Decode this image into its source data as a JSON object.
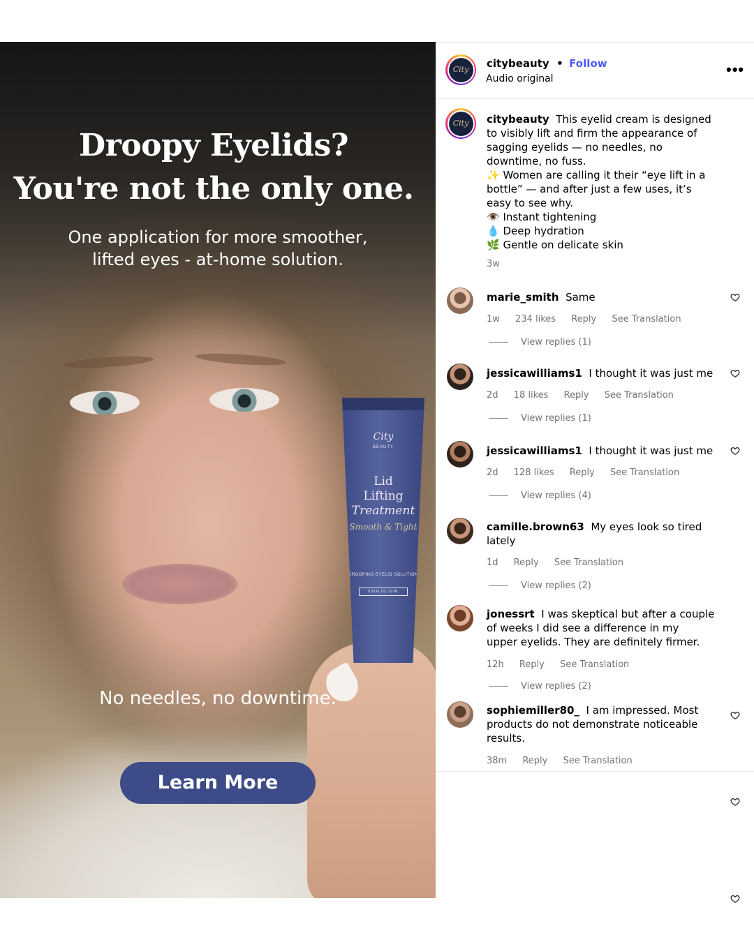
{
  "ad": {
    "headline_1": "Droopy Eyelids?",
    "headline_2": "You're not the only one.",
    "subline_1": "One application for more smoother,",
    "subline_2": "lifted eyes - at-home solution.",
    "tagline": "No needles, no downtime.",
    "cta_label": "Learn More",
    "product": {
      "brand": "City",
      "brand_sub": "BEAUTY",
      "title_1": "Lid",
      "title_2": "Lifting",
      "title_3": "Treatment",
      "subtitle": "Smooth & Tight",
      "desc": "DROOPING EYELID SOLUTION",
      "size": "0.33 FL OZ / 10 ML"
    }
  },
  "post": {
    "username": "citybeauty",
    "follow_label": "Follow",
    "separator": "•",
    "audio": "Audio original",
    "logo_text": "City",
    "caption": {
      "username": "citybeauty",
      "line1": "This eyelid cream is designed",
      "line2": "to visibly lift and firm the appearance of",
      "line3": "sagging eyelids — no needles, no",
      "line4": "downtime, no fuss.",
      "line5": "✨ Women are calling it their “eye lift in a",
      "line6": "bottle” — and after just a few uses, it’s",
      "line7": "easy to see why.",
      "line8": "👁️ Instant tightening",
      "line9": "💧 Deep hydration",
      "line10": "🌿 Gentle on delicate skin",
      "time": "3w"
    }
  },
  "comments": [
    {
      "user": "marie_smith",
      "text_1": "Same",
      "text_2": "",
      "text_3": "",
      "time": "1w",
      "likes": "234 likes",
      "reply": "Reply",
      "translate": "See Translation",
      "replies": "View replies (1)"
    },
    {
      "user": "jessicawilliams1",
      "text_1": "I thought it was just me",
      "text_2": "",
      "text_3": "",
      "time": "2d",
      "likes": "18 likes",
      "reply": "Reply",
      "translate": "See Translation",
      "replies": "View replies (1)"
    },
    {
      "user": "jessicawilliams1",
      "text_1": "I thought it was just me",
      "text_2": "",
      "text_3": "",
      "time": "2d",
      "likes": "128 likes",
      "reply": "Reply",
      "translate": "See Translation",
      "replies": "View replies (4)"
    },
    {
      "user": "camille.brown63",
      "text_1": "My eyes look so tired",
      "text_2": "lately",
      "text_3": "",
      "time": "1d",
      "likes": "",
      "reply": "Reply",
      "translate": "See Translation",
      "replies": "View replies (2)"
    },
    {
      "user": "jonessrt",
      "text_1": "I was skeptical but after a couple",
      "text_2": "of weeks I did see a difference in my",
      "text_3": "upper eyelids. They are definitely firmer.",
      "time": "12h",
      "likes": "",
      "reply": "Reply",
      "translate": "See Translation",
      "replies": "View replies (2)"
    },
    {
      "user": "sophiemiller80_",
      "text_1": "I am impressed. Most",
      "text_2": "products do not demonstrate noticeable",
      "text_3": "results.",
      "time": "38m",
      "likes": "",
      "reply": "Reply",
      "translate": "See Translation",
      "replies": ""
    }
  ],
  "icons": {
    "more": "more-horizontal-icon",
    "like": "heart-outline-icon"
  },
  "colors": {
    "follow": "#4a5df9",
    "cta": "#3d4c88",
    "meta": "#737373"
  }
}
